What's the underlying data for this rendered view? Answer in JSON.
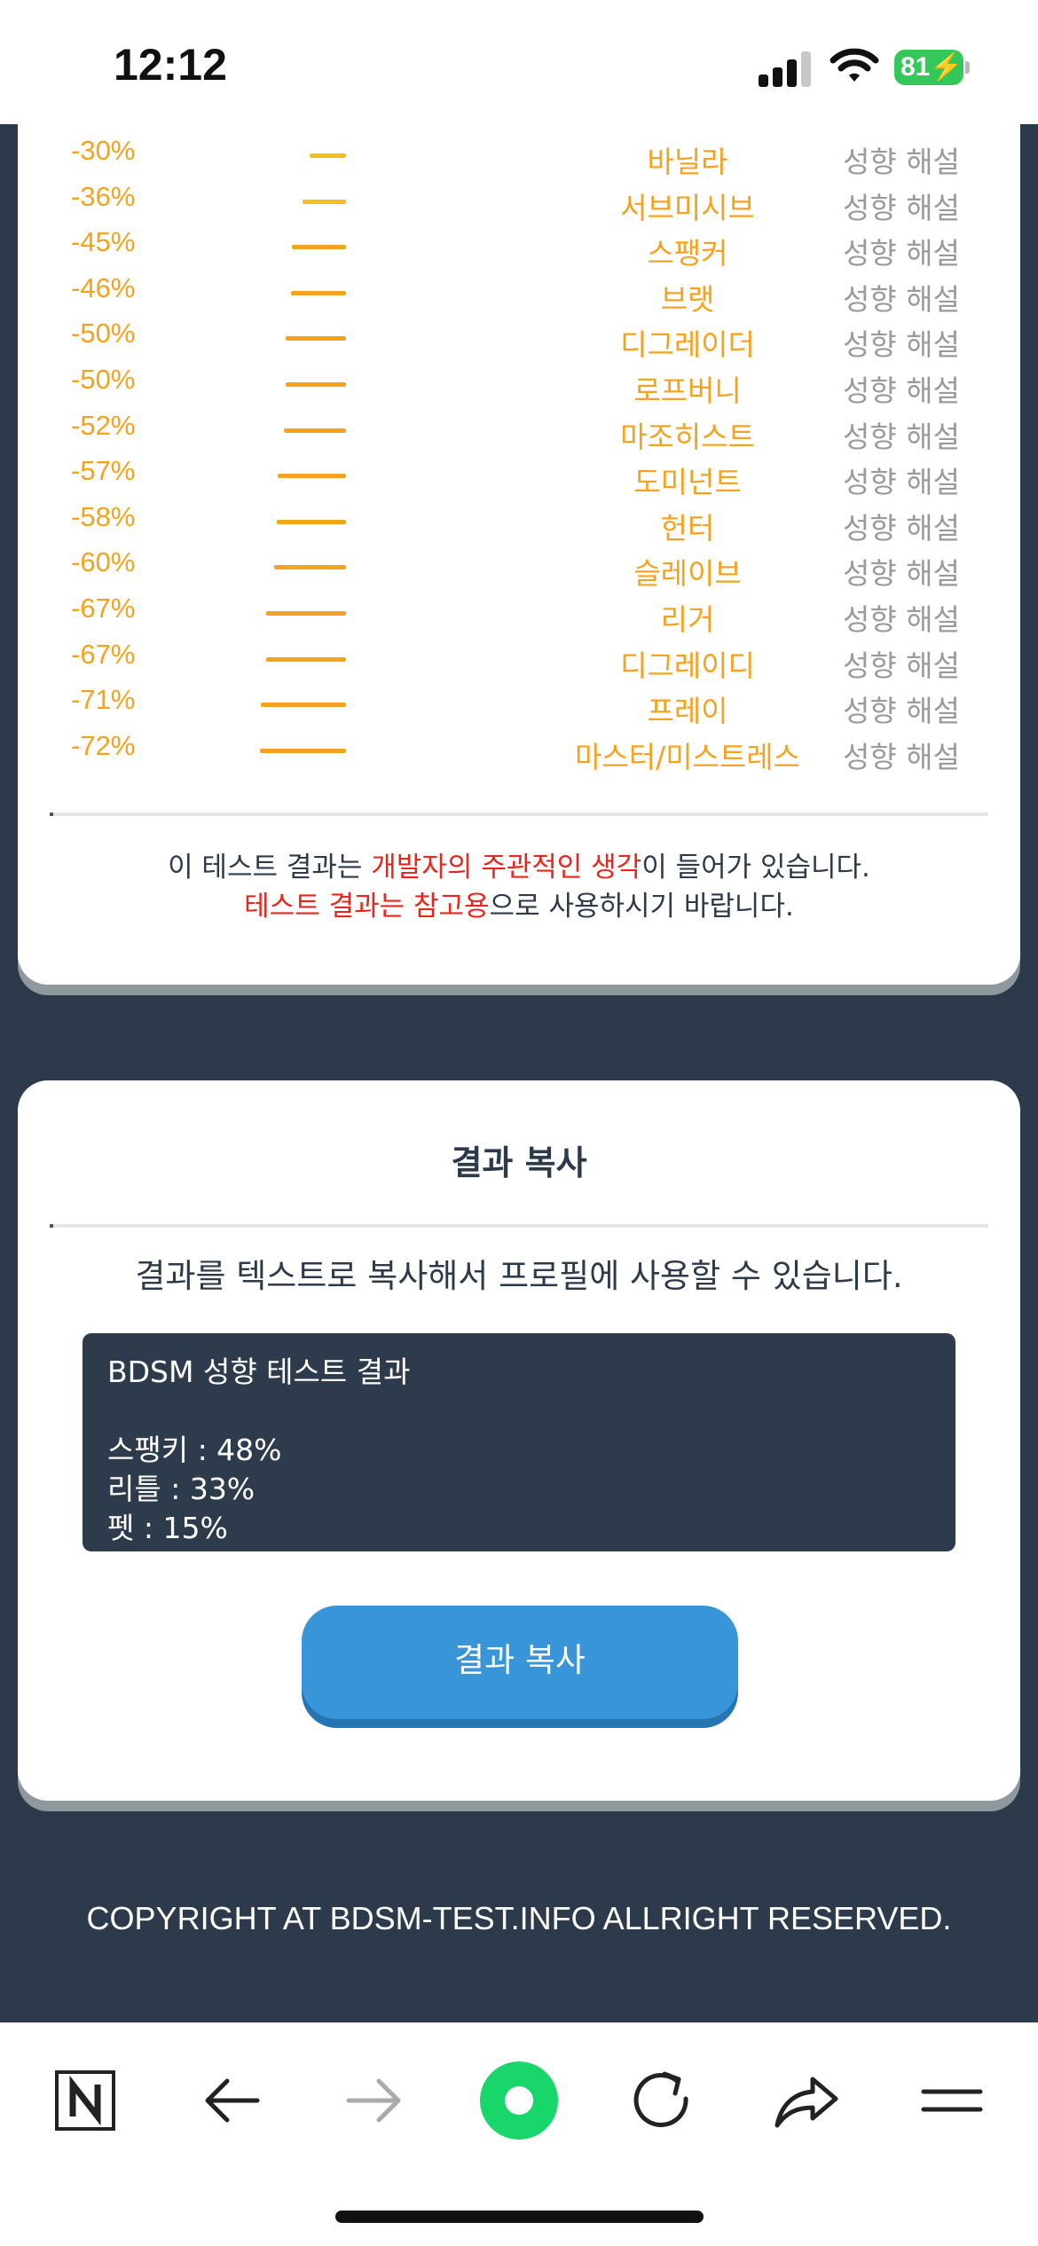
{
  "status": {
    "time": "12:12",
    "battery": "81"
  },
  "ranking_rows": [
    {
      "percent": "-30%",
      "name": "바닐라",
      "link": "성향 해설",
      "level": 0.3
    },
    {
      "percent": "-36%",
      "name": "서브미시브",
      "link": "성향 해설",
      "level": 0.36
    },
    {
      "percent": "-45%",
      "name": "스팽커",
      "link": "성향 해설",
      "level": 0.45
    },
    {
      "percent": "-46%",
      "name": "브랫",
      "link": "성향 해설",
      "level": 0.46
    },
    {
      "percent": "-50%",
      "name": "디그레이더",
      "link": "성향 해설",
      "level": 0.5
    },
    {
      "percent": "-50%",
      "name": "로프버니",
      "link": "성향 해설",
      "level": 0.5
    },
    {
      "percent": "-52%",
      "name": "마조히스트",
      "link": "성향 해설",
      "level": 0.52
    },
    {
      "percent": "-57%",
      "name": "도미넌트",
      "link": "성향 해설",
      "level": 0.57
    },
    {
      "percent": "-58%",
      "name": "헌터",
      "link": "성향 해설",
      "level": 0.58
    },
    {
      "percent": "-60%",
      "name": "슬레이브",
      "link": "성향 해설",
      "level": 0.6
    },
    {
      "percent": "-67%",
      "name": "리거",
      "link": "성향 해설",
      "level": 0.67
    },
    {
      "percent": "-67%",
      "name": "디그레이디",
      "link": "성향 해설",
      "level": 0.67
    },
    {
      "percent": "-71%",
      "name": "프레이",
      "link": "성향 해설",
      "level": 0.71
    },
    {
      "percent": "-72%",
      "name": "마스터/미스트레스",
      "link": "성향 해설",
      "level": 0.72
    }
  ],
  "disclaimer": {
    "line1_pre": "이 테스트 결과는 ",
    "line1_highlight": "개발자의 주관적인 생각",
    "line1_post": "이 들어가 있습니다.",
    "line2_highlight": "테스트 결과는 참고용",
    "line2_post": "으로 사용하시기 바랍니다."
  },
  "copy_section": {
    "title": "결과 복사",
    "description": "결과를 텍스트로 복사해서 프로필에 사용할 수 있습니다.",
    "result_heading": "BDSM 성향 테스트 결과",
    "result_lines": [
      "스팽키 : 48%",
      "리틀 : 33%",
      "펫 : 15%"
    ],
    "button_label": "결과 복사"
  },
  "footer": {
    "copyright": "COPYRIGHT AT BDSM-TEST.INFO ALLRIGHT RESERVED."
  },
  "toolbar_icons": [
    "naver-n-icon",
    "back-arrow-icon",
    "forward-arrow-icon",
    "green-dot-icon",
    "reload-icon",
    "share-icon",
    "menu-icon"
  ],
  "colors": {
    "accent_orange": "#f5a31f",
    "highlight_red": "#e8261d",
    "button_blue": "#3895d8",
    "page_bg": "#2c3a4b"
  }
}
